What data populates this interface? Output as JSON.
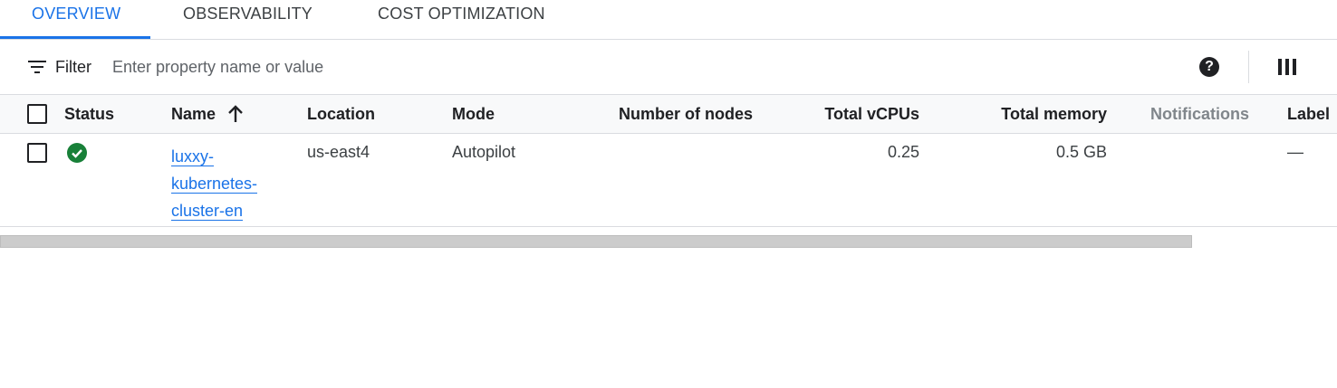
{
  "tabs": [
    {
      "label": "OVERVIEW",
      "active": true
    },
    {
      "label": "OBSERVABILITY",
      "active": false
    },
    {
      "label": "COST OPTIMIZATION",
      "active": false
    }
  ],
  "filter": {
    "label": "Filter",
    "placeholder": "Enter property name or value",
    "value": ""
  },
  "toolbar": {
    "help_icon": "help-circle-icon",
    "column_icon": "column-display-icon"
  },
  "table": {
    "headers": {
      "status": "Status",
      "name": "Name",
      "location": "Location",
      "mode": "Mode",
      "nodes": "Number of nodes",
      "vcpus": "Total vCPUs",
      "memory": "Total memory",
      "notifications": "Notifications",
      "labels": "Label"
    },
    "sort": {
      "column": "Name",
      "direction": "ascending"
    },
    "rows": [
      {
        "status": "ok",
        "name_lines": [
          "luxxy-",
          "kubernetes-",
          "cluster-en"
        ],
        "location": "us-east4",
        "mode": "Autopilot",
        "nodes": "",
        "vcpus": "0.25",
        "memory": "0.5 GB",
        "notifications": "",
        "labels": "—"
      }
    ]
  },
  "colors": {
    "accent": "#1a73e8",
    "status_ok": "#188038",
    "header_bg": "#f8f9fa",
    "divider": "#dadce0"
  }
}
